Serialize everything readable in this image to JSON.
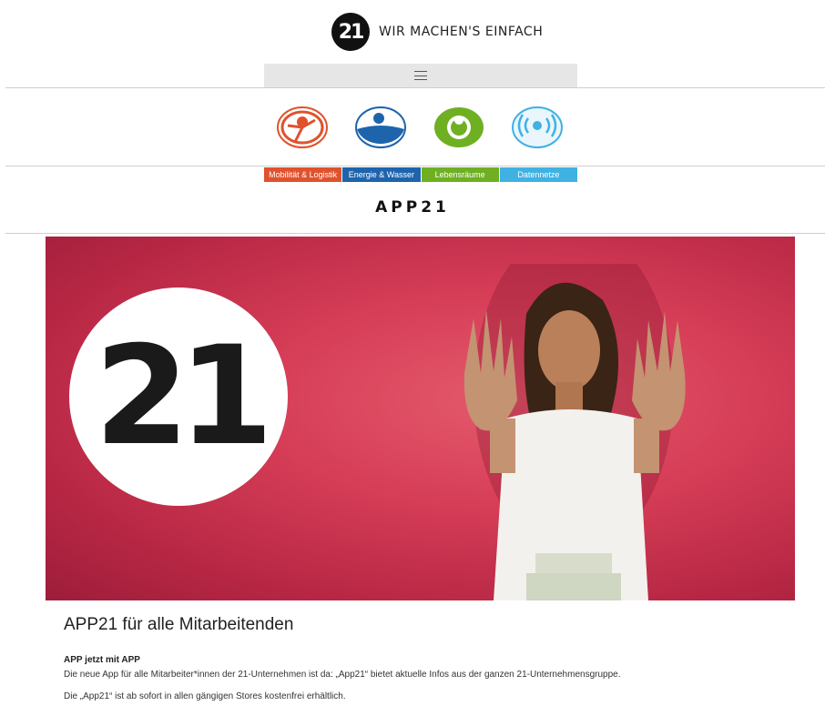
{
  "header": {
    "logo_text": "21",
    "tagline": "WIR MACHEN'S EINFACH"
  },
  "menu": {
    "icon": "hamburger-menu-icon"
  },
  "categories": [
    {
      "label": "Mobilität & Logistik",
      "color": "#e0522d",
      "icon": "mobility-disc-icon"
    },
    {
      "label": "Energie & Wasser",
      "color": "#1e64ad",
      "icon": "energy-water-disc-icon"
    },
    {
      "label": "Lebensräume",
      "color": "#6fb022",
      "icon": "gear-disc-icon"
    },
    {
      "label": "Datennetze",
      "color": "#3fb2e3",
      "icon": "signal-waves-disc-icon"
    }
  ],
  "page": {
    "title": "APP21"
  },
  "hero": {
    "logo_text": "21"
  },
  "content": {
    "title": "APP21 für alle Mitarbeitenden",
    "subheading": "APP jetzt mit APP",
    "paragraph1": "Die neue App für alle Mitarbeiter*innen der 21-Unternehmen ist da: „App21“ bietet aktuelle Infos aus der ganzen 21-Unternehmensgruppe.",
    "paragraph2": "Die „App21“ ist ab sofort in allen gängigen Stores kostenfrei erhältlich."
  }
}
